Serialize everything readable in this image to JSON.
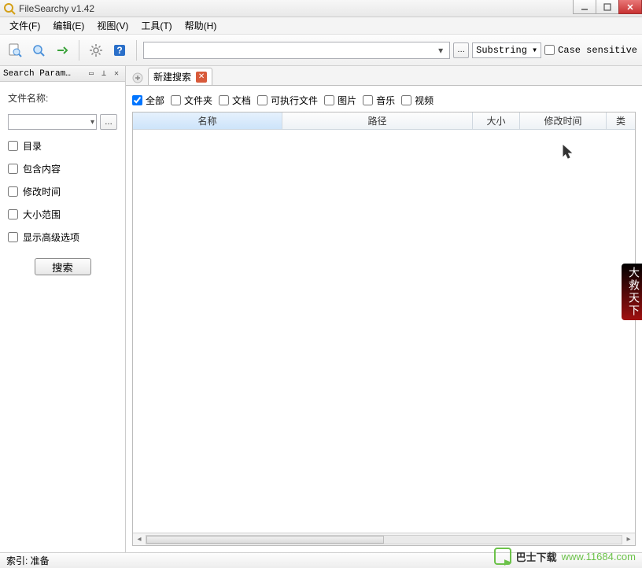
{
  "window": {
    "title": "FileSearchy v1.42"
  },
  "menu": {
    "file": "文件(F)",
    "edit": "编辑(E)",
    "view": "视图(V)",
    "tools": "工具(T)",
    "help": "帮助(H)"
  },
  "toolbar": {
    "search_value": "",
    "search_mode": "Substring",
    "case_sensitive_label": "Case sensitive",
    "case_sensitive_checked": false
  },
  "sidebar": {
    "panel_title": "Search Param…",
    "filename_label": "文件名称:",
    "filename_value": "",
    "checks": {
      "directory": "目录",
      "include_content": "包含内容",
      "mod_time": "修改时间",
      "size_range": "大小范围",
      "show_advanced": "显示高级选项"
    },
    "search_button": "搜索"
  },
  "tabs": {
    "new_search": "新建搜索"
  },
  "filters": {
    "all": "全部",
    "folder": "文件夹",
    "document": "文档",
    "executable": "可执行文件",
    "image": "图片",
    "music": "音乐",
    "video": "视频"
  },
  "columns": {
    "name": "名称",
    "path": "路径",
    "size": "大小",
    "modified": "修改时间",
    "type": "类"
  },
  "statusbar": {
    "text": "索引: 准备"
  },
  "watermark": {
    "name": "巴士下载",
    "url": "www.11684.com"
  },
  "side_badge": "大救天下"
}
